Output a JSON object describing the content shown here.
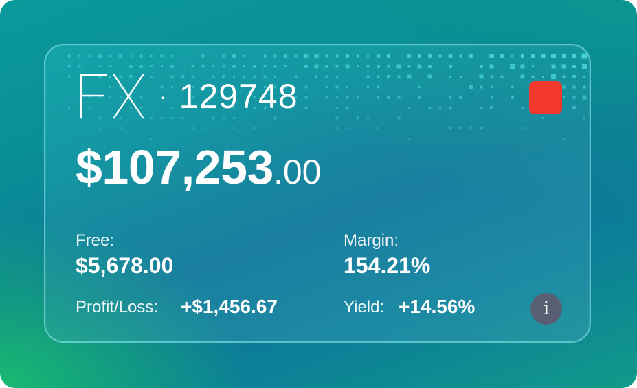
{
  "card": {
    "brand": "FX",
    "separator": "·",
    "account_number": "129748",
    "balance_main": "$107,253",
    "balance_cents": ".00",
    "status_color": "#f2372c"
  },
  "stats": {
    "free_label": "Free:",
    "free_value": "$5,678.00",
    "margin_label": "Margin:",
    "margin_value": "154.21%",
    "pl_label": "Profit/Loss:",
    "pl_value": "+$1,456.67",
    "yield_label": "Yield:",
    "yield_value": "+14.56%"
  },
  "info_button": {
    "icon": "info-icon",
    "glyph": "i"
  },
  "colors": {
    "background_teal": "#0a8c97",
    "background_green": "#19be6e",
    "accent_red": "#f2372c",
    "info_bg": "#585f73"
  }
}
